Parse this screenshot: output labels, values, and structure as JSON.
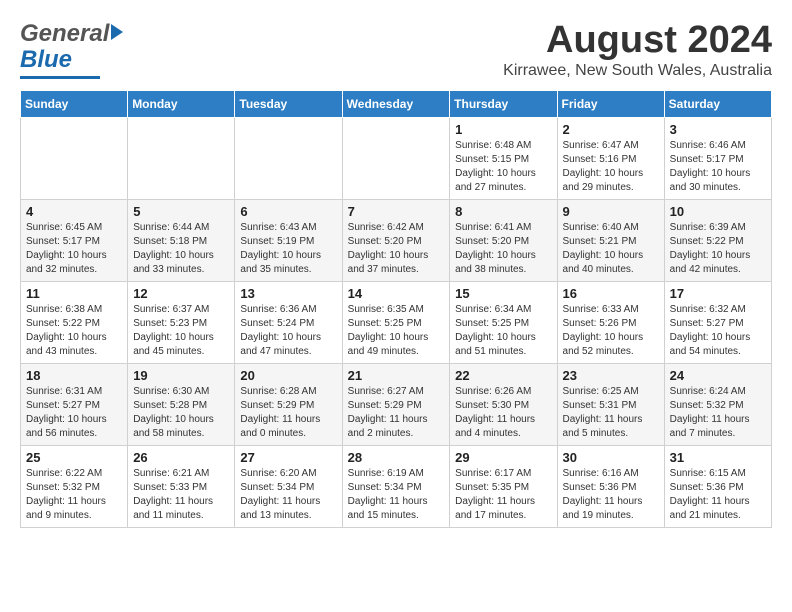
{
  "header": {
    "logo_general": "General",
    "logo_blue": "Blue",
    "month": "August 2024",
    "location": "Kirrawee, New South Wales, Australia"
  },
  "days_of_week": [
    "Sunday",
    "Monday",
    "Tuesday",
    "Wednesday",
    "Thursday",
    "Friday",
    "Saturday"
  ],
  "weeks": [
    [
      {
        "day": "",
        "info": ""
      },
      {
        "day": "",
        "info": ""
      },
      {
        "day": "",
        "info": ""
      },
      {
        "day": "",
        "info": ""
      },
      {
        "day": "1",
        "info": "Sunrise: 6:48 AM\nSunset: 5:15 PM\nDaylight: 10 hours\nand 27 minutes."
      },
      {
        "day": "2",
        "info": "Sunrise: 6:47 AM\nSunset: 5:16 PM\nDaylight: 10 hours\nand 29 minutes."
      },
      {
        "day": "3",
        "info": "Sunrise: 6:46 AM\nSunset: 5:17 PM\nDaylight: 10 hours\nand 30 minutes."
      }
    ],
    [
      {
        "day": "4",
        "info": "Sunrise: 6:45 AM\nSunset: 5:17 PM\nDaylight: 10 hours\nand 32 minutes."
      },
      {
        "day": "5",
        "info": "Sunrise: 6:44 AM\nSunset: 5:18 PM\nDaylight: 10 hours\nand 33 minutes."
      },
      {
        "day": "6",
        "info": "Sunrise: 6:43 AM\nSunset: 5:19 PM\nDaylight: 10 hours\nand 35 minutes."
      },
      {
        "day": "7",
        "info": "Sunrise: 6:42 AM\nSunset: 5:20 PM\nDaylight: 10 hours\nand 37 minutes."
      },
      {
        "day": "8",
        "info": "Sunrise: 6:41 AM\nSunset: 5:20 PM\nDaylight: 10 hours\nand 38 minutes."
      },
      {
        "day": "9",
        "info": "Sunrise: 6:40 AM\nSunset: 5:21 PM\nDaylight: 10 hours\nand 40 minutes."
      },
      {
        "day": "10",
        "info": "Sunrise: 6:39 AM\nSunset: 5:22 PM\nDaylight: 10 hours\nand 42 minutes."
      }
    ],
    [
      {
        "day": "11",
        "info": "Sunrise: 6:38 AM\nSunset: 5:22 PM\nDaylight: 10 hours\nand 43 minutes."
      },
      {
        "day": "12",
        "info": "Sunrise: 6:37 AM\nSunset: 5:23 PM\nDaylight: 10 hours\nand 45 minutes."
      },
      {
        "day": "13",
        "info": "Sunrise: 6:36 AM\nSunset: 5:24 PM\nDaylight: 10 hours\nand 47 minutes."
      },
      {
        "day": "14",
        "info": "Sunrise: 6:35 AM\nSunset: 5:25 PM\nDaylight: 10 hours\nand 49 minutes."
      },
      {
        "day": "15",
        "info": "Sunrise: 6:34 AM\nSunset: 5:25 PM\nDaylight: 10 hours\nand 51 minutes."
      },
      {
        "day": "16",
        "info": "Sunrise: 6:33 AM\nSunset: 5:26 PM\nDaylight: 10 hours\nand 52 minutes."
      },
      {
        "day": "17",
        "info": "Sunrise: 6:32 AM\nSunset: 5:27 PM\nDaylight: 10 hours\nand 54 minutes."
      }
    ],
    [
      {
        "day": "18",
        "info": "Sunrise: 6:31 AM\nSunset: 5:27 PM\nDaylight: 10 hours\nand 56 minutes."
      },
      {
        "day": "19",
        "info": "Sunrise: 6:30 AM\nSunset: 5:28 PM\nDaylight: 10 hours\nand 58 minutes."
      },
      {
        "day": "20",
        "info": "Sunrise: 6:28 AM\nSunset: 5:29 PM\nDaylight: 11 hours\nand 0 minutes."
      },
      {
        "day": "21",
        "info": "Sunrise: 6:27 AM\nSunset: 5:29 PM\nDaylight: 11 hours\nand 2 minutes."
      },
      {
        "day": "22",
        "info": "Sunrise: 6:26 AM\nSunset: 5:30 PM\nDaylight: 11 hours\nand 4 minutes."
      },
      {
        "day": "23",
        "info": "Sunrise: 6:25 AM\nSunset: 5:31 PM\nDaylight: 11 hours\nand 5 minutes."
      },
      {
        "day": "24",
        "info": "Sunrise: 6:24 AM\nSunset: 5:32 PM\nDaylight: 11 hours\nand 7 minutes."
      }
    ],
    [
      {
        "day": "25",
        "info": "Sunrise: 6:22 AM\nSunset: 5:32 PM\nDaylight: 11 hours\nand 9 minutes."
      },
      {
        "day": "26",
        "info": "Sunrise: 6:21 AM\nSunset: 5:33 PM\nDaylight: 11 hours\nand 11 minutes."
      },
      {
        "day": "27",
        "info": "Sunrise: 6:20 AM\nSunset: 5:34 PM\nDaylight: 11 hours\nand 13 minutes."
      },
      {
        "day": "28",
        "info": "Sunrise: 6:19 AM\nSunset: 5:34 PM\nDaylight: 11 hours\nand 15 minutes."
      },
      {
        "day": "29",
        "info": "Sunrise: 6:17 AM\nSunset: 5:35 PM\nDaylight: 11 hours\nand 17 minutes."
      },
      {
        "day": "30",
        "info": "Sunrise: 6:16 AM\nSunset: 5:36 PM\nDaylight: 11 hours\nand 19 minutes."
      },
      {
        "day": "31",
        "info": "Sunrise: 6:15 AM\nSunset: 5:36 PM\nDaylight: 11 hours\nand 21 minutes."
      }
    ]
  ]
}
